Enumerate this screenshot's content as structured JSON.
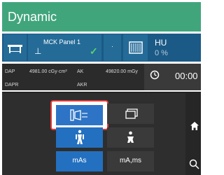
{
  "header": {
    "title": "Dynamic"
  },
  "toolbar": {
    "panel": {
      "label": "MCK Panel 1",
      "dash": "⊥",
      "check": "✓"
    },
    "dot": "·",
    "hu": {
      "label": "HU",
      "value": "0 %"
    }
  },
  "dose": {
    "dap_label": "DAP",
    "dap_value": "4981.00 cGy·cm²",
    "ak_label": "AK",
    "ak_value": "49820.00 mGy",
    "dapr_label": "DAPR",
    "akr_label": "AKR",
    "time": "00:00"
  },
  "tiles": {
    "mas_label": "mAs",
    "mams_label": "mA,ms"
  },
  "icons": {
    "table": "table-icon",
    "grid": "grid-icon",
    "clock": "clock-icon",
    "panel_view": "panel-view-icon",
    "window": "window-icon",
    "person": "person-icon",
    "child": "child-icon",
    "home": "home-icon"
  },
  "colors": {
    "header": "#41a57c",
    "toolbar": "#1b5a86",
    "tile_blue": "#2370c0",
    "highlight": "#e23b3b"
  }
}
